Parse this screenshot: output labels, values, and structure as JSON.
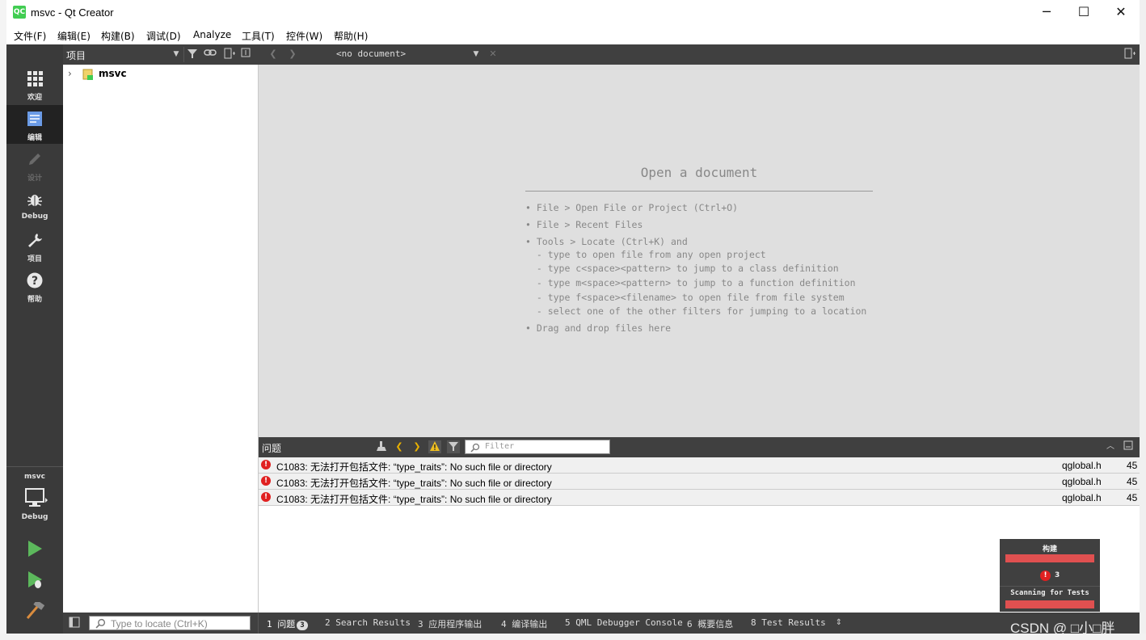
{
  "window": {
    "title": "msvc - Qt Creator",
    "app_icon": "QC",
    "minimize": "─",
    "maximize": "☐",
    "close": "✕"
  },
  "menu": [
    "文件(F)",
    "编辑(E)",
    "构建(B)",
    "调试(D)",
    "Analyze",
    "工具(T)",
    "控件(W)",
    "帮助(H)"
  ],
  "sidebar": {
    "modes": [
      {
        "label": "欢迎",
        "icon": "grid-icon"
      },
      {
        "label": "编辑",
        "icon": "document-icon",
        "active": true
      },
      {
        "label": "设计",
        "icon": "pencil-icon",
        "disabled": true
      },
      {
        "label": "Debug",
        "icon": "bug-icon"
      },
      {
        "label": "项目",
        "icon": "wrench-icon"
      },
      {
        "label": "帮助",
        "icon": "help-icon"
      }
    ],
    "kit": "msvc",
    "build_mode": "Debug"
  },
  "project_pane": {
    "title": "项目",
    "tree": [
      {
        "name": "msvc",
        "icon": "qt-project-icon",
        "expanded": false
      }
    ]
  },
  "editor": {
    "document_combo": "<no document>",
    "open_title": "Open a document",
    "hints": [
      "• File > Open File or Project (Ctrl+O)",
      "• File > Recent Files",
      "• Tools > Locate (Ctrl+K) and",
      "  - type to open file from any open project",
      "  - type c<space><pattern> to jump to a class definition",
      "  - type m<space><pattern> to jump to a function definition",
      "  - type f<space><filename> to open file from file system",
      "  - select one of the other filters for jumping to a location",
      "• Drag and drop files here"
    ]
  },
  "issues_pane": {
    "title": "问题",
    "filter_placeholder": "Filter",
    "rows": [
      {
        "message": "C1083: 无法打开包括文件: “type_traits”: No such file or directory",
        "file": "qglobal.h",
        "line": "45"
      },
      {
        "message": "C1083: 无法打开包括文件: “type_traits”: No such file or directory",
        "file": "qglobal.h",
        "line": "45"
      },
      {
        "message": "C1083: 无法打开包括文件: “type_traits”: No such file or directory",
        "file": "qglobal.h",
        "line": "45"
      }
    ]
  },
  "statusbar": {
    "locator_placeholder": "Type to locate (Ctrl+K)",
    "panes": [
      {
        "number": "1",
        "label": "问题",
        "badge": "3"
      },
      {
        "number": "2",
        "label": "Search Results"
      },
      {
        "number": "3",
        "label": "应用程序输出"
      },
      {
        "number": "4",
        "label": "编译输出"
      },
      {
        "number": "5",
        "label": "QML Debugger Console"
      },
      {
        "number": "6",
        "label": "概要信息"
      },
      {
        "number": "8",
        "label": "Test Results"
      }
    ]
  },
  "progress": {
    "build_label": "构建",
    "error_count": "3",
    "scan_label": "Scanning for Tests"
  },
  "watermark": "CSDN @ □小□胖",
  "colors": {
    "sidebar": "#3a3a3a",
    "toolbar": "#404040",
    "editor_bg": "#dfdfdf",
    "error": "#e02020",
    "progress_bar": "#e05050"
  }
}
